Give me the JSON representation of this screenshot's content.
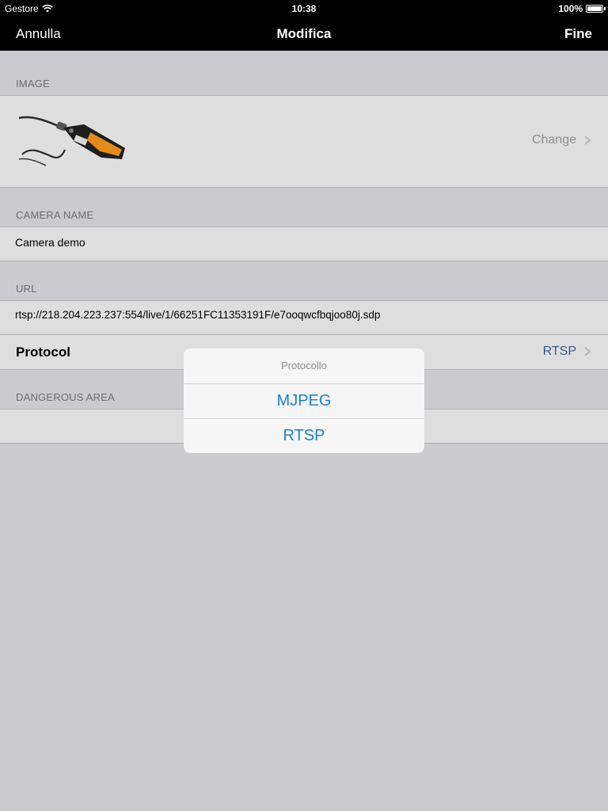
{
  "status_bar": {
    "carrier": "Gestore",
    "time": "10:38",
    "battery": "100%",
    "wifi_icon": "wifi-icon",
    "battery_icon": "battery-icon"
  },
  "nav": {
    "left": "Annulla",
    "title": "Modifica",
    "right": "Fine"
  },
  "sections": {
    "image": {
      "header": "IMAGE",
      "action": "Change"
    },
    "camera_name": {
      "header": "CAMERA NAME",
      "value": "Camera demo"
    },
    "url": {
      "header": "URL",
      "value": "rtsp://218.204.223.237:554/live/1/66251FC11353191F/e7ooqwcfbqjoo80j.sdp"
    },
    "protocol": {
      "label": "Protocol",
      "value": "RTSP"
    },
    "dangerous_area": {
      "header": "DANGEROUS AREA"
    }
  },
  "alert": {
    "title": "Protocollo",
    "options": [
      "MJPEG",
      "RTSP"
    ]
  },
  "colors": {
    "background": "#cbcacf",
    "cell": "#dedede",
    "bar": "#000000",
    "accent": "#1b7fd9",
    "section_header": "#6d6d72"
  }
}
